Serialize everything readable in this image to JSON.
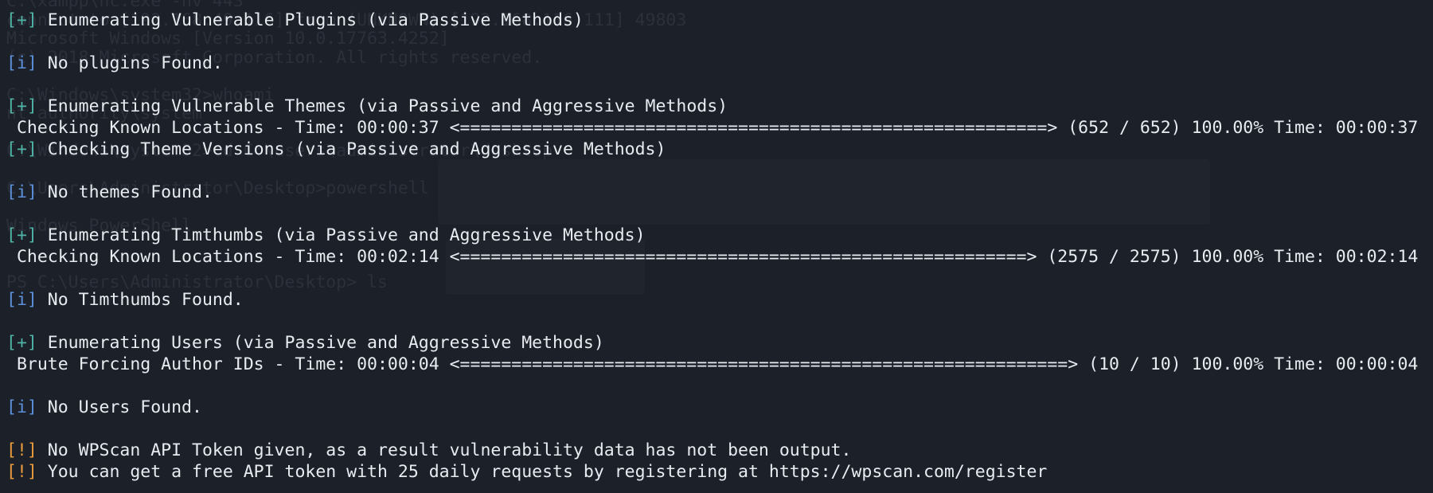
{
  "terminal": {
    "ghost_lines": [
      "C:\\xampp\\nc.exe -nv 443",
      "connect to [192.168.49.116] from (UNKNOWN) [192.168.116.111] 49803",
      "Microsoft Windows [Version 10.0.17763.4252]",
      "(c) 2018 Microsoft Corporation. All rights reserved.",
      "",
      "C:\\Windows\\system32>whoami",
      "nt authority\\system",
      "",
      "C:\\Windows\\system32>cd C:\\users\\administrator\\desktop",
      "",
      "C:\\Users\\Administrator\\Desktop>powershell",
      "",
      "Windows PowerShell",
      "",
      "",
      "PS C:\\Users\\Administrator\\Desktop> ls"
    ],
    "lines": [
      {
        "prefix": "[+]",
        "type": "plus",
        "text": " Enumerating Vulnerable Plugins (via Passive Methods)"
      },
      {
        "prefix": "",
        "type": "blank",
        "text": ""
      },
      {
        "prefix": "[i]",
        "type": "info",
        "text": " No plugins Found."
      },
      {
        "prefix": "",
        "type": "blank",
        "text": ""
      },
      {
        "prefix": "[+]",
        "type": "plus",
        "text": " Enumerating Vulnerable Themes (via Passive and Aggressive Methods)"
      },
      {
        "prefix": "",
        "type": "progress",
        "text": " Checking Known Locations - Time: 00:00:37 <=========================================================> (652 / 652) 100.00% Time: 00:00:37"
      },
      {
        "prefix": "[+]",
        "type": "plus",
        "text": " Checking Theme Versions (via Passive and Aggressive Methods)"
      },
      {
        "prefix": "",
        "type": "blank",
        "text": ""
      },
      {
        "prefix": "[i]",
        "type": "info",
        "text": " No themes Found."
      },
      {
        "prefix": "",
        "type": "blank",
        "text": ""
      },
      {
        "prefix": "[+]",
        "type": "plus",
        "text": " Enumerating Timthumbs (via Passive and Aggressive Methods)"
      },
      {
        "prefix": "",
        "type": "progress",
        "text": " Checking Known Locations - Time: 00:02:14 <=======================================================> (2575 / 2575) 100.00% Time: 00:02:14"
      },
      {
        "prefix": "",
        "type": "blank",
        "text": ""
      },
      {
        "prefix": "[i]",
        "type": "info",
        "text": " No Timthumbs Found."
      },
      {
        "prefix": "",
        "type": "blank",
        "text": ""
      },
      {
        "prefix": "[+]",
        "type": "plus",
        "text": " Enumerating Users (via Passive and Aggressive Methods)"
      },
      {
        "prefix": "",
        "type": "progress",
        "text": " Brute Forcing Author IDs - Time: 00:00:04 <===========================================================> (10 / 10) 100.00% Time: 00:00:04"
      },
      {
        "prefix": "",
        "type": "blank",
        "text": ""
      },
      {
        "prefix": "[i]",
        "type": "info",
        "text": " No Users Found."
      },
      {
        "prefix": "",
        "type": "blank",
        "text": ""
      },
      {
        "prefix": "[!]",
        "type": "warn",
        "text": " No WPScan API Token given, as a result vulnerability data has not been output."
      },
      {
        "prefix": "[!]",
        "type": "warn",
        "text": " You can get a free API token with 25 daily requests by registering at https://wpscan.com/register"
      }
    ]
  },
  "colors": {
    "background": "#1c2029",
    "text": "#e8ecf0",
    "plus_prefix": "#4fb3a6",
    "info_prefix": "#5b8fd9",
    "warn_prefix": "#e89a3c"
  }
}
